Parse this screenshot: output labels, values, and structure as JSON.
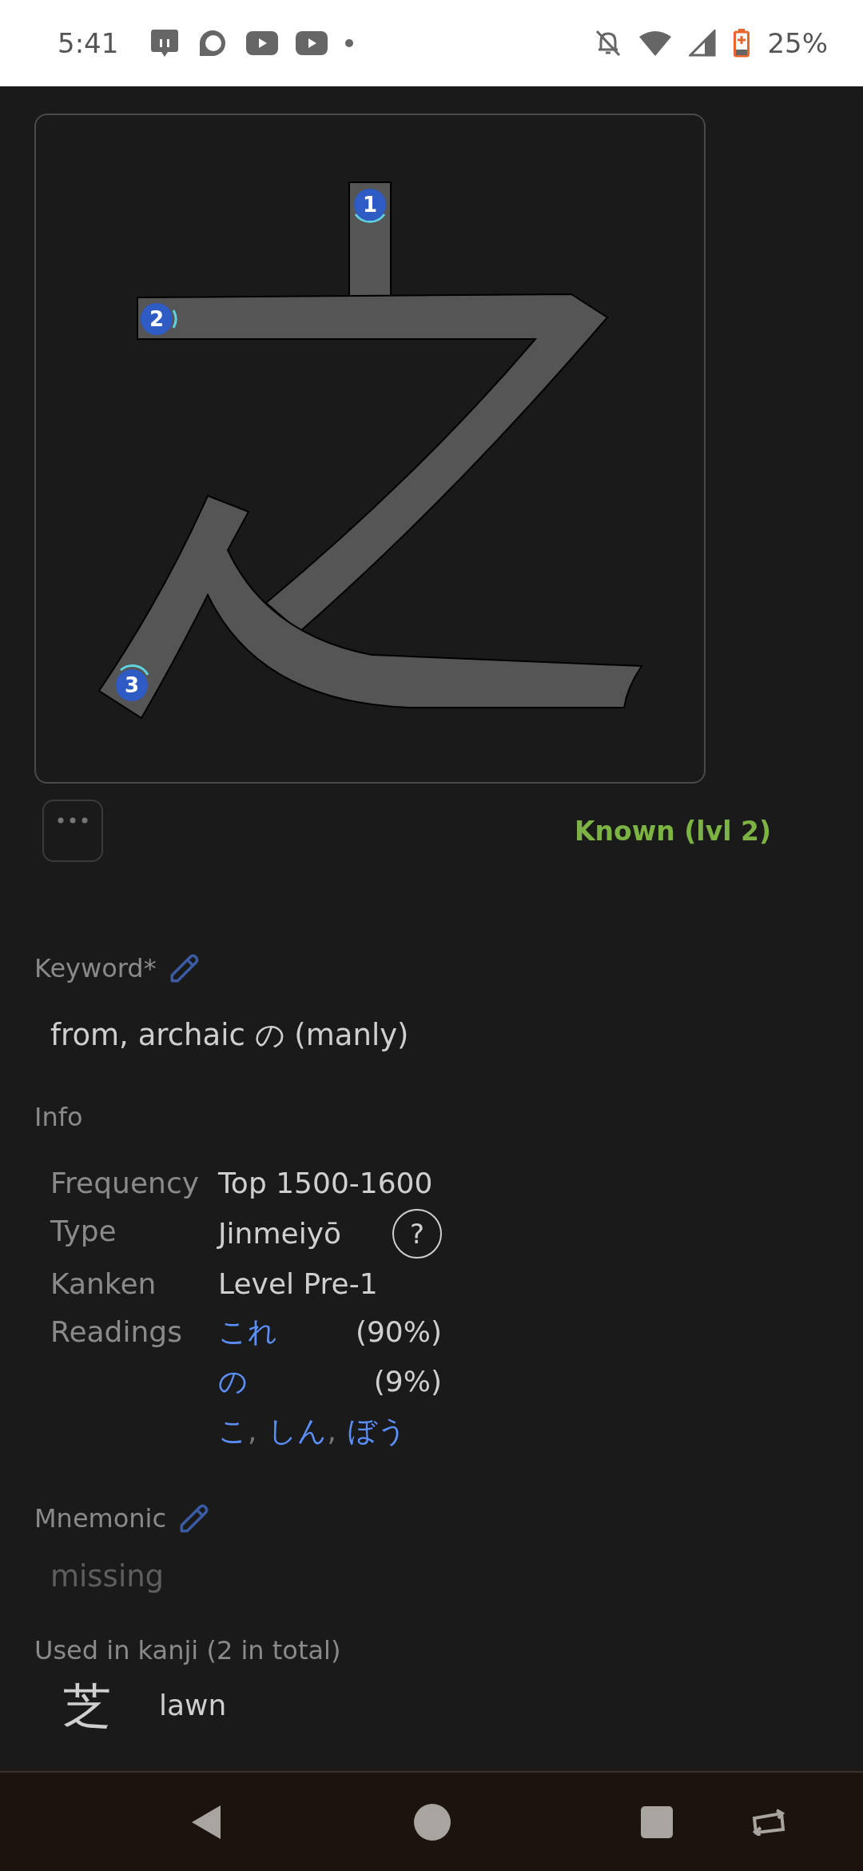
{
  "status_bar": {
    "time": "5:41",
    "battery": "25%"
  },
  "kanji_diagram": {
    "strokes": [
      {
        "number": "1"
      },
      {
        "number": "2"
      },
      {
        "number": "3"
      }
    ]
  },
  "status": {
    "text": "Known (lvl 2)"
  },
  "keyword": {
    "label": "Keyword*",
    "value": "from, archaic の (manly)"
  },
  "info": {
    "label": "Info",
    "rows": [
      {
        "kind": "text",
        "label": "Frequency",
        "value": "Top 1500-1600"
      },
      {
        "kind": "help",
        "label": "Type",
        "value": "Jinmeiyō",
        "help": "?"
      },
      {
        "kind": "text",
        "label": "Kanken",
        "value": "Level Pre-1"
      },
      {
        "kind": "readings",
        "label": "Readings",
        "readings": [
          {
            "text": "これ",
            "share": "(90%)"
          },
          {
            "text": "の",
            "share": "(9%)"
          }
        ],
        "other_readings": [
          {
            "text": "こ",
            "separator": ","
          },
          {
            "text": "しん",
            "separator": ","
          },
          {
            "text": "ぼう"
          }
        ]
      }
    ]
  },
  "mnemonic": {
    "label": "Mnemonic",
    "value": "missing"
  },
  "used_in": {
    "label": "Used in kanji (2 in total)",
    "items": [
      {
        "kanji": "芝",
        "meaning": "lawn"
      }
    ]
  }
}
